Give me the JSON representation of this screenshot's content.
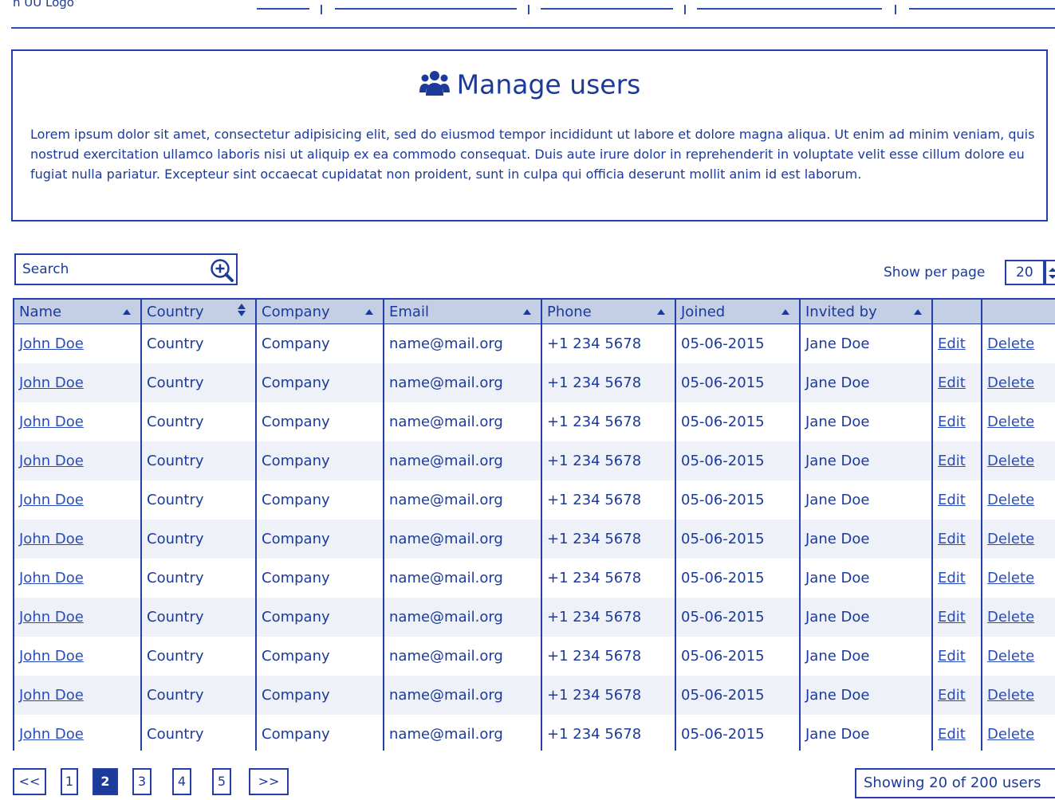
{
  "nav": {
    "logo_text": "n UU Logo"
  },
  "header": {
    "title": "Manage users",
    "title_icon": "users-icon",
    "intro": "Lorem ipsum dolor sit amet, consectetur adipisicing elit, sed do eiusmod tempor incididunt ut labore et dolore magna aliqua. Ut enim ad minim veniam, quis nostrud exercitation ullamco laboris nisi ut aliquip ex ea commodo consequat. Duis aute irure dolor in reprehenderit in voluptate velit esse cillum dolore eu fugiat nulla pariatur. Excepteur sint occaecat cupidatat non proident, sunt in culpa qui officia deserunt mollit anim id est laborum."
  },
  "toolbar": {
    "search_placeholder": "Search",
    "search_icon": "zoom-in-icon",
    "per_page_label": "Show per page",
    "per_page_value": "20"
  },
  "table": {
    "columns": [
      {
        "label": "Name",
        "sort": "asc"
      },
      {
        "label": "Country",
        "sort": "both"
      },
      {
        "label": "Company",
        "sort": "asc"
      },
      {
        "label": "Email",
        "sort": "asc"
      },
      {
        "label": "Phone",
        "sort": "asc"
      },
      {
        "label": "Joined",
        "sort": "asc"
      },
      {
        "label": "Invited by",
        "sort": "asc"
      },
      {
        "label": "",
        "sort": "none"
      },
      {
        "label": "",
        "sort": "none"
      }
    ],
    "rows": [
      {
        "name": "John Doe",
        "country": "Country",
        "company": "Company",
        "email": "name@mail.org",
        "phone": "+1 234 5678",
        "joined": "05-06-2015",
        "invited_by": "Jane Doe",
        "edit": "Edit",
        "delete": "Delete"
      },
      {
        "name": "John Doe",
        "country": "Country",
        "company": "Company",
        "email": "name@mail.org",
        "phone": "+1 234 5678",
        "joined": "05-06-2015",
        "invited_by": "Jane Doe",
        "edit": "Edit",
        "delete": "Delete"
      },
      {
        "name": "John Doe",
        "country": "Country",
        "company": "Company",
        "email": "name@mail.org",
        "phone": "+1 234 5678",
        "joined": "05-06-2015",
        "invited_by": "Jane Doe",
        "edit": "Edit",
        "delete": "Delete"
      },
      {
        "name": "John Doe",
        "country": "Country",
        "company": "Company",
        "email": "name@mail.org",
        "phone": "+1 234 5678",
        "joined": "05-06-2015",
        "invited_by": "Jane Doe",
        "edit": "Edit",
        "delete": "Delete"
      },
      {
        "name": "John Doe",
        "country": "Country",
        "company": "Company",
        "email": "name@mail.org",
        "phone": "+1 234 5678",
        "joined": "05-06-2015",
        "invited_by": "Jane Doe",
        "edit": "Edit",
        "delete": "Delete"
      },
      {
        "name": "John Doe",
        "country": "Country",
        "company": "Company",
        "email": "name@mail.org",
        "phone": "+1 234 5678",
        "joined": "05-06-2015",
        "invited_by": "Jane Doe",
        "edit": "Edit",
        "delete": "Delete"
      },
      {
        "name": "John Doe",
        "country": "Country",
        "company": "Company",
        "email": "name@mail.org",
        "phone": "+1 234 5678",
        "joined": "05-06-2015",
        "invited_by": "Jane Doe",
        "edit": "Edit",
        "delete": "Delete"
      },
      {
        "name": "John Doe",
        "country": "Country",
        "company": "Company",
        "email": "name@mail.org",
        "phone": "+1 234 5678",
        "joined": "05-06-2015",
        "invited_by": "Jane Doe",
        "edit": "Edit",
        "delete": "Delete"
      },
      {
        "name": "John Doe",
        "country": "Country",
        "company": "Company",
        "email": "name@mail.org",
        "phone": "+1 234 5678",
        "joined": "05-06-2015",
        "invited_by": "Jane Doe",
        "edit": "Edit",
        "delete": "Delete"
      },
      {
        "name": "John Doe",
        "country": "Country",
        "company": "Company",
        "email": "name@mail.org",
        "phone": "+1 234 5678",
        "joined": "05-06-2015",
        "invited_by": "Jane Doe",
        "edit": "Edit",
        "delete": "Delete"
      },
      {
        "name": "John Doe",
        "country": "Country",
        "company": "Company",
        "email": "name@mail.org",
        "phone": "+1 234 5678",
        "joined": "05-06-2015",
        "invited_by": "Jane Doe",
        "edit": "Edit",
        "delete": "Delete"
      }
    ]
  },
  "pagination": {
    "prev": "<<",
    "pages": [
      "1",
      "2",
      "3",
      "4",
      "5"
    ],
    "current": "2",
    "next": ">>",
    "summary": "Showing 20 of 200 users"
  },
  "colors": {
    "ink": "#1c3a9a",
    "header_row_bg": "#c4cfe6",
    "alt_row_bg": "#eef1f8"
  }
}
